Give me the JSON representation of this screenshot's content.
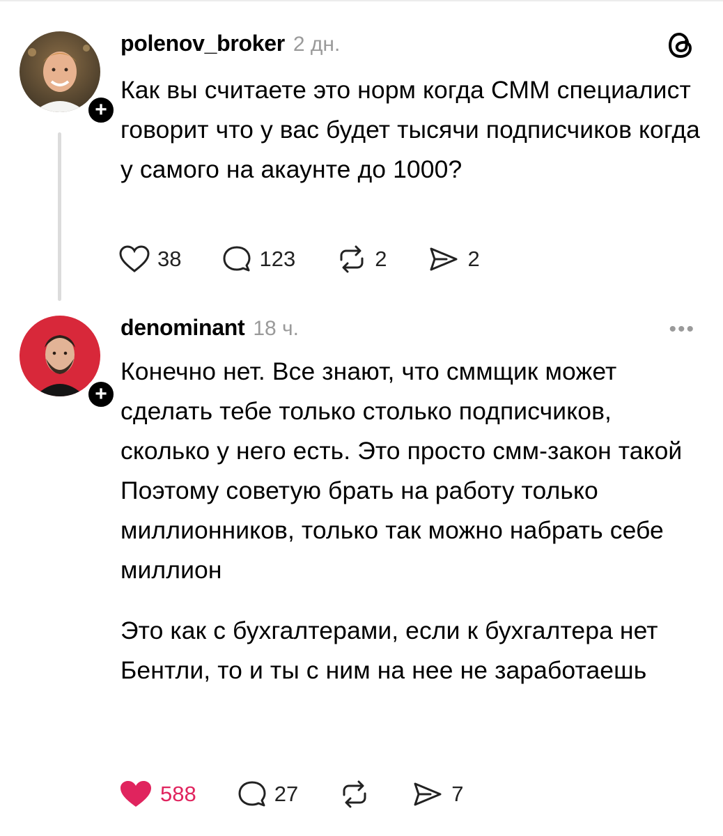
{
  "post1": {
    "username": "polenov_broker",
    "time": "2 дн.",
    "text": "Как вы считаете это норм когда СММ специалист говорит что у вас будет тысячи подписчиков когда у самого на акаунте до 1000?",
    "likes": "38",
    "replies": "123",
    "reposts": "2",
    "shares": "2",
    "menu_icon": "threads-logo-icon"
  },
  "post2": {
    "username": "denominant",
    "time": "18 ч.",
    "paragraph1": "Конечно нет. Все знают, что сммщик может сделать тебе только столько подписчиков, сколько у него есть. Это просто смм-закон такой",
    "paragraph2": "Поэтому советую брать на работу только миллионников, только так можно набрать себе миллион",
    "paragraph3": "Это как с бухгалтерами, если к бухгалтера нет Бентли, то и ты с ним на нее не заработаешь",
    "likes": "588",
    "liked": true,
    "replies": "27",
    "shares": "7",
    "more_label": "•••"
  },
  "follow_badge": "+",
  "colors": {
    "like_active": "#e0245e",
    "muted": "#9a9a9a",
    "thread_line": "#dcdcdc"
  }
}
